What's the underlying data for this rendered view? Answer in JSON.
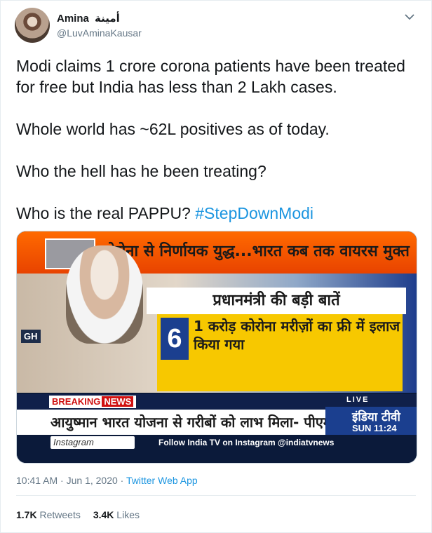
{
  "author": {
    "name": "Amina",
    "name_arabic": "أمينة",
    "handle": "@LuvAminaKausar"
  },
  "tweet": {
    "paragraphs": [
      "Modi claims 1 crore corona patients have been treated for free but India has less than 2 Lakh cases.",
      "Whole world has ~62L positives as of today.",
      "Who the hell has he been treating?"
    ],
    "last_line_prefix": "Who is the real PAPPU? ",
    "hashtag": "#StepDownModi"
  },
  "media": {
    "headline": "कोरोना से निर्णायक युद्ध...भारत कब तक वायरस मुक्त ?",
    "panel_title": "प्रधानमंत्री की बड़ी बातें",
    "panel_number": "6",
    "panel_text": "1 करोड़ कोरोना मरीज़ों का फ्री में इलाज किया गया",
    "side_label": "GH",
    "breaking": "BREAKING",
    "breaking_news": "NEWS",
    "live": "LIVE",
    "ticker": "आयुष्मान भारत योजना से गरीबों को लाभ मिला- पीएम",
    "brand": "इंडिया टीवी",
    "clock": "SUN 11:24",
    "instagram": "Instagram",
    "follow": "Follow India TV on Instagram @indiatvnews"
  },
  "meta": {
    "time": "10:41 AM",
    "sep1": " · ",
    "date": "Jun 1, 2020",
    "sep2": " · ",
    "source": "Twitter Web App"
  },
  "stats": {
    "retweets_count": "1.7K",
    "retweets_label": "Retweets",
    "likes_count": "3.4K",
    "likes_label": "Likes"
  },
  "colors": {
    "accent": "#1b95e0",
    "secondary_text": "#657786"
  }
}
